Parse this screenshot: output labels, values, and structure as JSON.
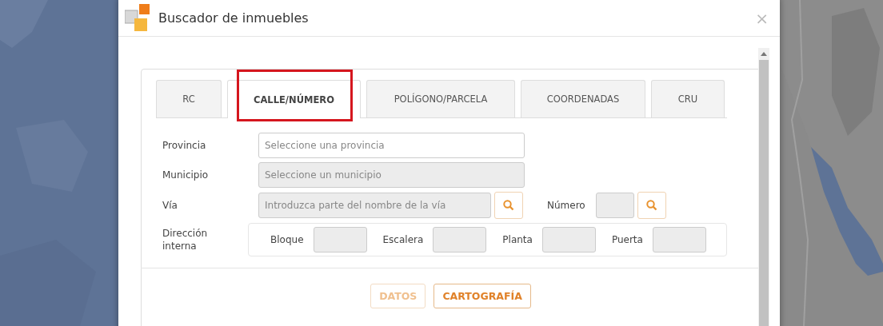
{
  "window": {
    "title": "Buscador de inmuebles",
    "close": "×"
  },
  "tabs": [
    {
      "label": "RC",
      "selected": false
    },
    {
      "label": "CALLE/NÚMERO",
      "selected": true
    },
    {
      "label": "POLÍGONO/PARCELA",
      "selected": false
    },
    {
      "label": "COORDENADAS",
      "selected": false
    },
    {
      "label": "CRU",
      "selected": false
    }
  ],
  "form": {
    "provincia": {
      "label": "Provincia",
      "placeholder": "Seleccione una provincia",
      "disabled": false
    },
    "municipio": {
      "label": "Municipio",
      "placeholder": "Seleccione un municipio",
      "disabled": true
    },
    "via": {
      "label": "Vía",
      "placeholder": "Introduzca parte del nombre de la vía",
      "disabled": true
    },
    "numero": {
      "label": "Número",
      "disabled": true
    },
    "direccion_interna": {
      "label": "Dirección interna",
      "fields": [
        {
          "label": "Bloque",
          "disabled": true
        },
        {
          "label": "Escalera",
          "disabled": true
        },
        {
          "label": "Planta",
          "disabled": true
        },
        {
          "label": "Puerta",
          "disabled": true
        }
      ]
    }
  },
  "buttons": [
    {
      "label": "DATOS",
      "disabled": true
    },
    {
      "label": "CARTOGRAFÍA",
      "disabled": false
    }
  ]
}
